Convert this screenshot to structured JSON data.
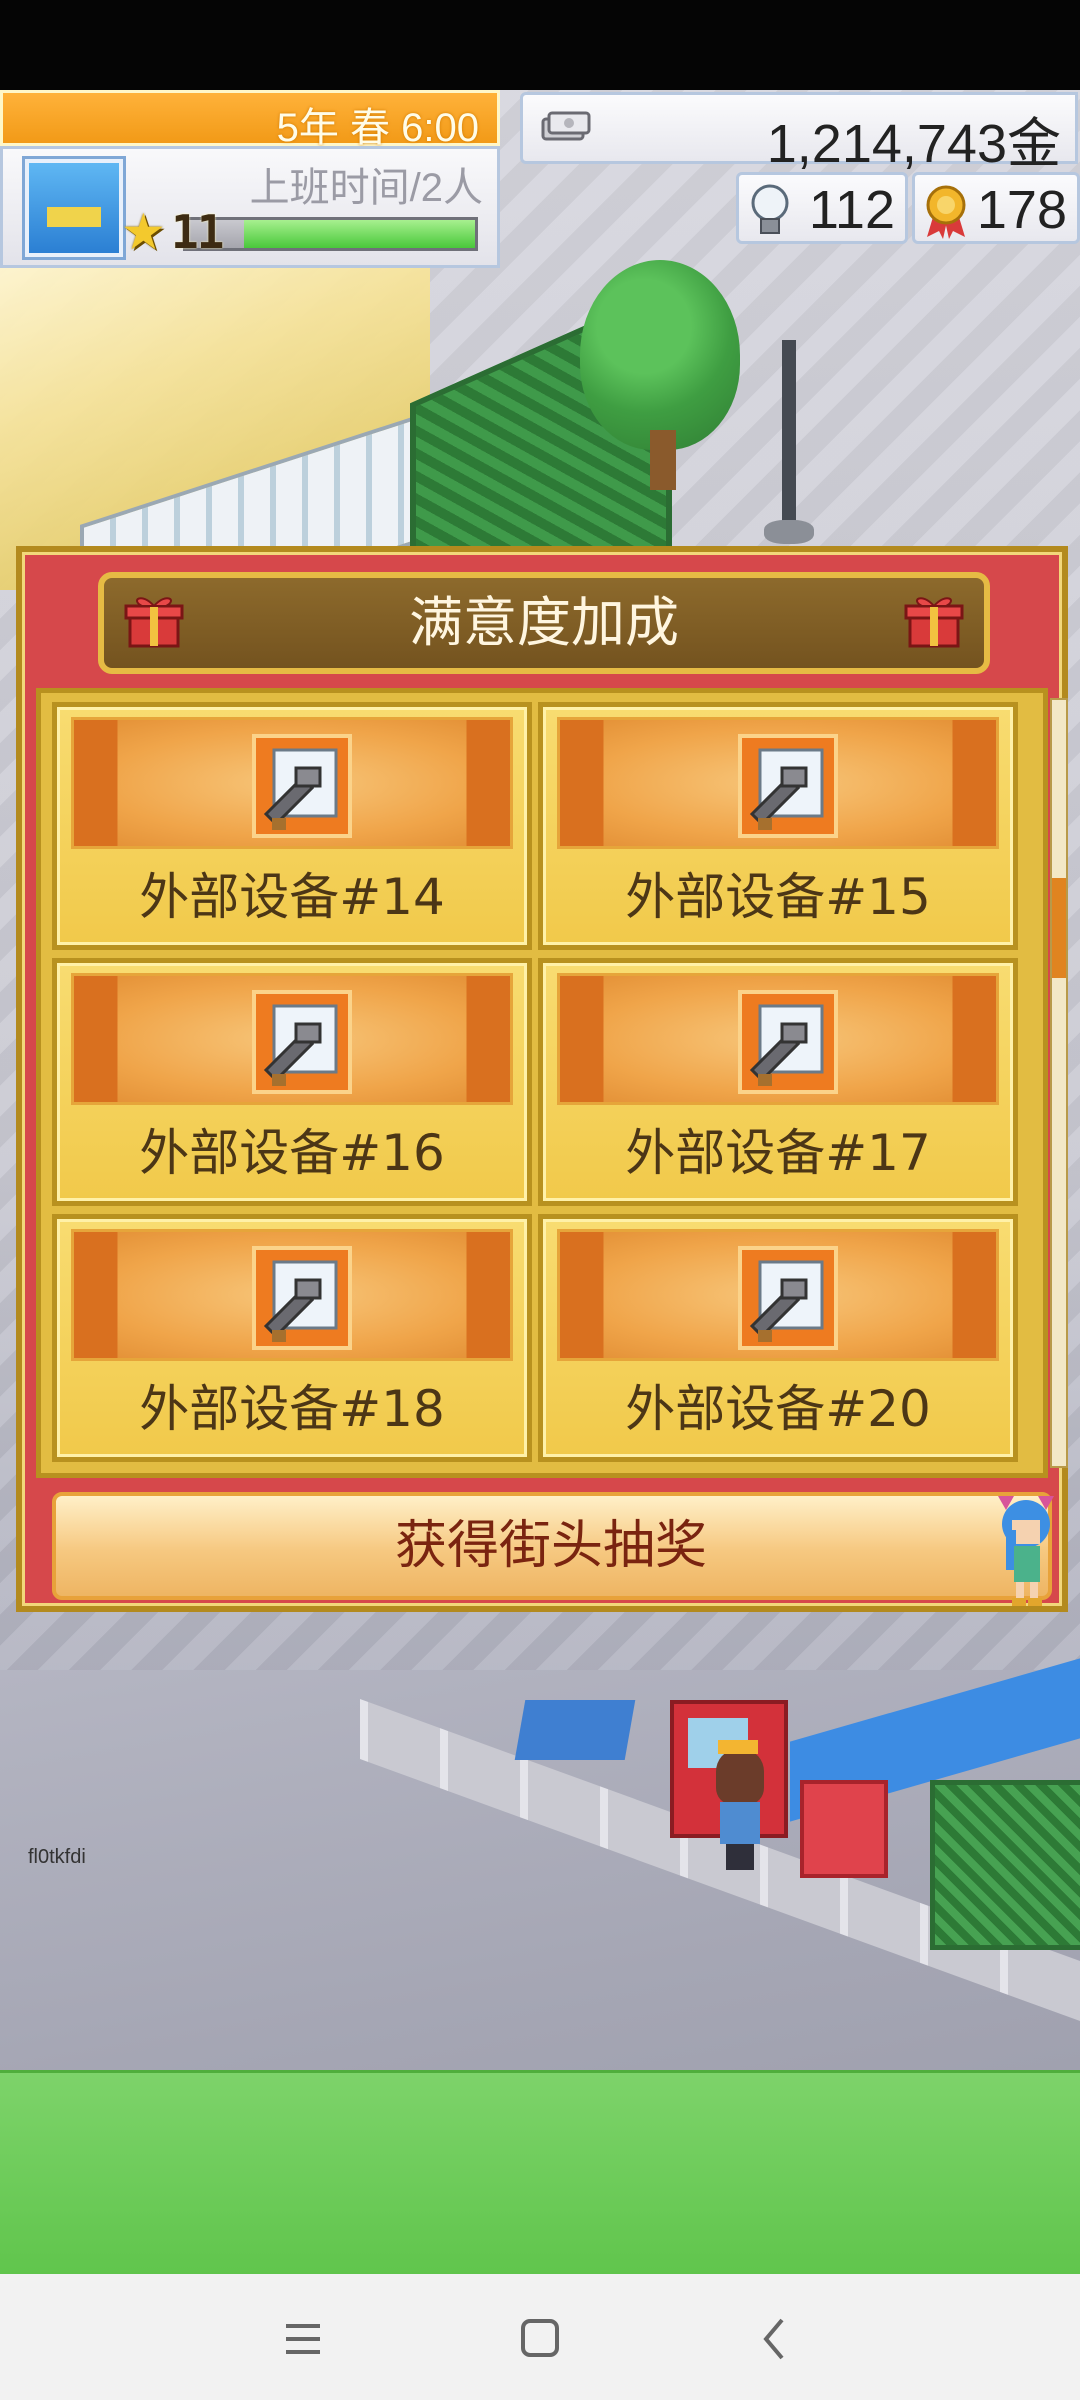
{
  "hud": {
    "date": "5年 春 6:00",
    "shift_status": "上班时间/2人",
    "level": "11",
    "level_progress": 0.8,
    "money": "1,214,743金",
    "research_points": "112",
    "medals": "178"
  },
  "dialog": {
    "title": "满意度加成",
    "items": [
      {
        "label": "外部设备#14",
        "icon": "wrench-icon"
      },
      {
        "label": "外部设备#15",
        "icon": "wrench-icon"
      },
      {
        "label": "外部设备#16",
        "icon": "wrench-icon"
      },
      {
        "label": "外部设备#17",
        "icon": "wrench-icon"
      },
      {
        "label": "外部设备#18",
        "icon": "wrench-icon"
      },
      {
        "label": "外部设备#20",
        "icon": "wrench-icon"
      }
    ],
    "lottery_button": "获得街头抽奖"
  },
  "debug_label": "fl0tkfdi",
  "colors": {
    "dialog_bg": "#d6484b",
    "dialog_frame": "#e2bc42",
    "header_bg": "#8d6a2c",
    "card_banner": "#f0a54a",
    "ad_banner": "#6acb55",
    "date_bar": "#f29a17"
  }
}
